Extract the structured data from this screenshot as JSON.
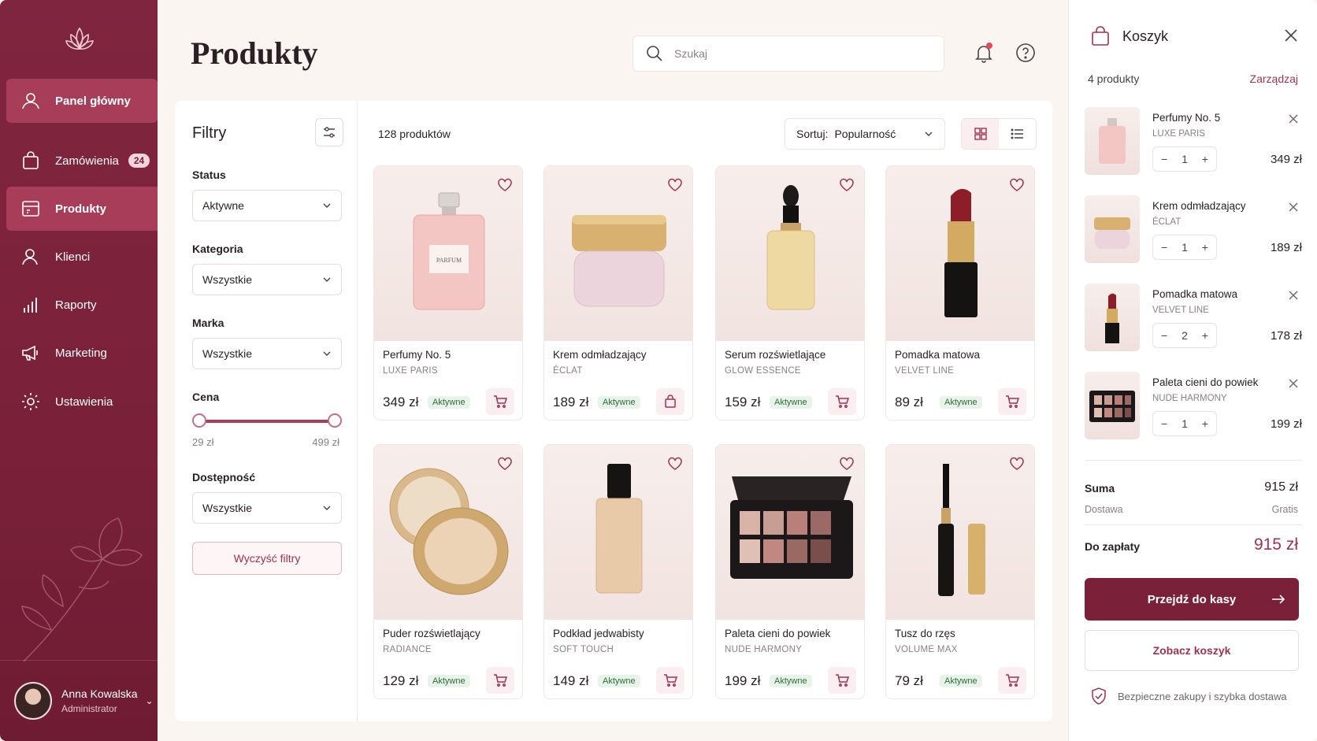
{
  "sidebar": {
    "items": [
      {
        "label": "Panel główny",
        "icon": "user-icon"
      },
      {
        "label": "Zamówienia",
        "icon": "bag-icon",
        "badge": "24"
      },
      {
        "label": "Produkty",
        "icon": "products-icon"
      },
      {
        "label": "Klienci",
        "icon": "users-icon"
      },
      {
        "label": "Raporty",
        "icon": "chart-bars-icon"
      },
      {
        "label": "Marketing",
        "icon": "megaphone-icon"
      },
      {
        "label": "Ustawienia",
        "icon": "gear-icon"
      }
    ],
    "user": {
      "name": "Anna Kowalska",
      "role": "Administrator"
    }
  },
  "header": {
    "title": "Produkty",
    "search_placeholder": "Szukaj"
  },
  "filters": {
    "title": "Filtry",
    "status_label": "Status",
    "status_value": "Aktywne",
    "category_label": "Kategoria",
    "category_value": "Wszystkie",
    "brand_label": "Marka",
    "brand_value": "Wszystkie",
    "price_label": "Cena",
    "price_min": "29 zł",
    "price_max": "499 zł",
    "availability_label": "Dostępność",
    "availability_value": "Wszystkie",
    "clear_label": "Wyczyść filtry"
  },
  "toolbar": {
    "count": "128 produktów",
    "sort_label": "Sortuj:",
    "sort_value": "Popularność"
  },
  "products": [
    {
      "name": "Perfumy No. 5",
      "brand": "LUXE PARIS",
      "price": "349 zł",
      "status": "Aktywne"
    },
    {
      "name": "Krem odmładzający",
      "brand": "ÉCLAT",
      "price": "189 zł",
      "status": "Aktywne"
    },
    {
      "name": "Serum rozświetlające",
      "brand": "GLOW ESSENCE",
      "price": "159 zł",
      "status": "Aktywne"
    },
    {
      "name": "Pomadka matowa",
      "brand": "VELVET LINE",
      "price": "89 zł",
      "status": "Aktywne"
    },
    {
      "name": "Puder rozświetlający",
      "brand": "RADIANCE",
      "price": "129 zł",
      "status": "Aktywne"
    },
    {
      "name": "Podkład jedwabisty",
      "brand": "SOFT TOUCH",
      "price": "149 zł",
      "status": "Aktywne"
    },
    {
      "name": "Paleta cieni do powiek",
      "brand": "NUDE HARMONY",
      "price": "199 zł",
      "status": "Aktywne"
    },
    {
      "name": "Tusz do rzęs",
      "brand": "VOLUME MAX",
      "price": "79 zł",
      "status": "Aktywne"
    }
  ],
  "cart": {
    "title": "Koszyk",
    "count": "4 produkty",
    "manage": "Zarządzaj",
    "items": [
      {
        "name": "Perfumy No. 5",
        "brand": "LUXE PARIS",
        "qty": "1",
        "price": "349 zł"
      },
      {
        "name": "Krem odmładzający",
        "brand": "ÉCLAT",
        "qty": "1",
        "price": "189 zł"
      },
      {
        "name": "Pomadka matowa",
        "brand": "VELVET LINE",
        "qty": "2",
        "price": "178 zł"
      },
      {
        "name": "Paleta cieni do powiek",
        "brand": "NUDE HARMONY",
        "qty": "1",
        "price": "199 zł"
      }
    ],
    "sum_label": "Suma",
    "sum_value": "915 zł",
    "shipping_label": "Dostawa",
    "shipping_value": "Gratis",
    "total_label": "Do zapłaty",
    "total_value": "915 zł",
    "checkout_label": "Przejdź do kasy",
    "view_cart_label": "Zobacz koszyk",
    "secure_note": "Bezpieczne zakupy i szybka dostawa"
  },
  "colors": {
    "brand": "#7a2139",
    "accent": "#a1314f",
    "active_nav": "#a73d58",
    "status_bg": "#e8f4ea"
  }
}
